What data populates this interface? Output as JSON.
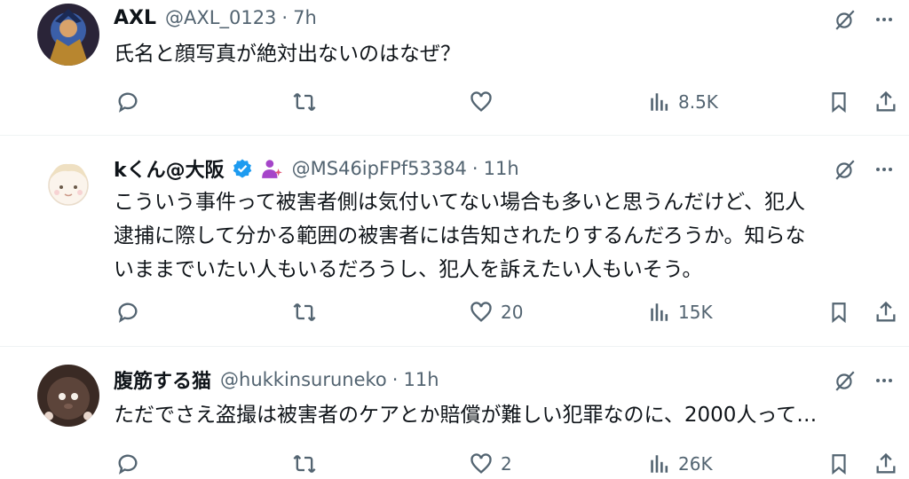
{
  "tweets": [
    {
      "display_name": "AXL",
      "handle": "@AXL_0123",
      "time": "7h",
      "text_lines": [
        "氏名と顔写真が絶対出ないのはなぜ？"
      ],
      "replies": "",
      "reposts": "",
      "likes": "",
      "views": "8.5K"
    },
    {
      "display_name": "kくん@大阪",
      "handle": "@MS46ipFPf53384",
      "time": "11h",
      "text_lines": [
        "こういう事件って被害者側は気付いてない場合も多いと思うんだけど、犯人",
        "逮捕に際して分かる範囲の被害者には告知されたりするんだろうか。知らな",
        "いままでいたい人もいるだろうし、犯人を訴えたい人もいそう。"
      ],
      "replies": "",
      "reposts": "",
      "likes": "20",
      "views": "15K"
    },
    {
      "display_name": "腹筋する猫",
      "handle": "@hukkinsuruneko",
      "time": "11h",
      "text_lines": [
        "ただでさえ盗撮は被害者のケアとか賠償が難しい犯罪なのに、2000人って…"
      ],
      "replies": "",
      "reposts": "",
      "likes": "2",
      "views": "26K"
    }
  ],
  "colors": {
    "text": "#0f1419",
    "secondary": "#536471",
    "verified": "#1d9bf0",
    "divider": "#eff3f4"
  },
  "icons": [
    "grok-slash-icon",
    "more-icon",
    "reply-icon",
    "repost-icon",
    "like-icon",
    "views-icon",
    "bookmark-icon",
    "share-icon",
    "verified-badge-icon",
    "person-sparkle-emoji-icon"
  ]
}
